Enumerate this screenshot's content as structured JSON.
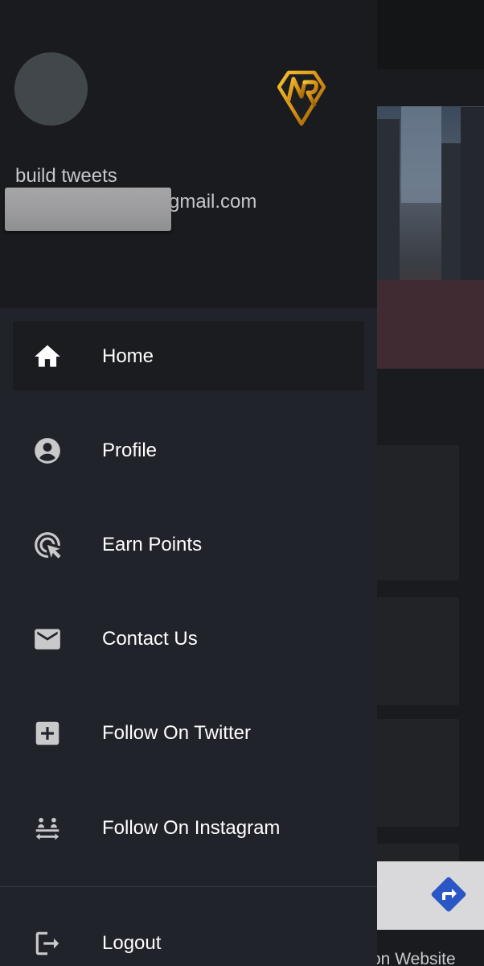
{
  "drawer": {
    "user_name": "build tweets",
    "user_email_suffix": "gmail.com",
    "menu": [
      {
        "label": "Home",
        "icon": "home-icon",
        "selected": true
      },
      {
        "label": "Profile",
        "icon": "account-circle-icon"
      },
      {
        "label": "Earn Points",
        "icon": "ads-click-icon"
      },
      {
        "label": "Contact Us",
        "icon": "mail-icon"
      },
      {
        "label": "Follow On Twitter",
        "icon": "add-box-icon"
      },
      {
        "label": "Follow On Instagram",
        "icon": "people-follow-icon"
      }
    ],
    "logout": {
      "label": "Logout",
      "icon": "logout-icon"
    },
    "logo": "diamond-nr-logo"
  },
  "background": {
    "banner_text": "on Website",
    "banner_icon": "directions-icon"
  },
  "colors": {
    "drawer_bg": "#20232a",
    "header_bg": "#191b1f",
    "selected_bg": "#1a1c20",
    "icon_gray": "#c8c9cb",
    "logo_gold": "#d9a21b",
    "directions_blue": "#2a56c6"
  }
}
